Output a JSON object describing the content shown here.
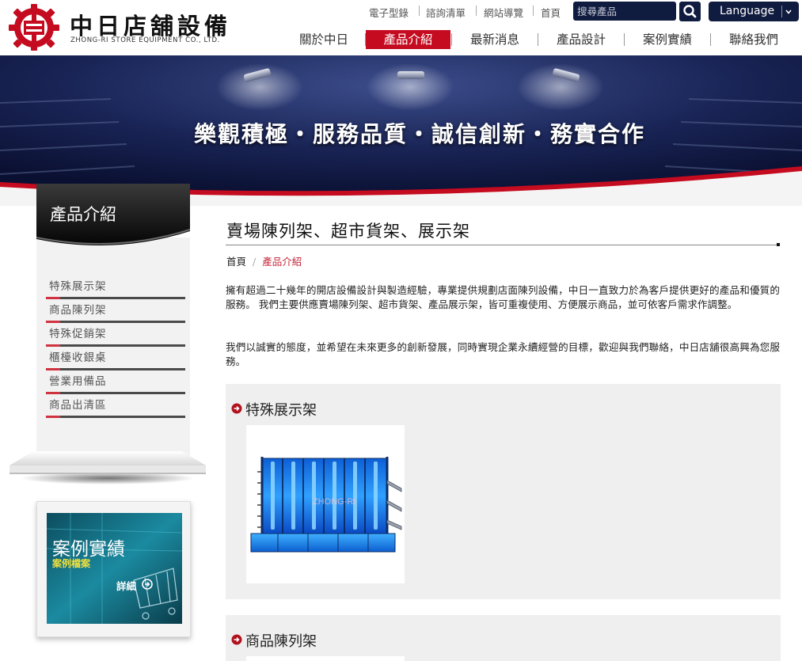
{
  "header": {
    "logo_cn": "中日店舖設備",
    "logo_en": "ZHONG-RI STORE EQUIPMENT CO., LTD.",
    "top_links": [
      "電子型錄",
      "諮詢清單",
      "網站導覽",
      "首頁"
    ],
    "search": {
      "placeholder": "搜尋產品",
      "icon": "search-icon"
    },
    "language": {
      "label": "Language",
      "icon": "chevron-down-icon"
    },
    "nav": [
      "關於中日",
      "產品介紹",
      "最新消息",
      "產品設計",
      "案例實績",
      "聯絡我們"
    ],
    "nav_active": "產品介紹",
    "colors": {
      "brand_red": "#c50b1f",
      "navy": "#0f1b3f"
    }
  },
  "banner": {
    "slogan": "樂觀積極・服務品質・誠信創新・務實合作"
  },
  "sidebar": {
    "title": "產品介紹",
    "items": [
      "特殊展示架",
      "商品陳列架",
      "特殊促銷架",
      "櫃檯收銀桌",
      "營業用備品",
      "商品出清區"
    ],
    "case_box": {
      "title": "案例實績",
      "subtitle": "案例檔案",
      "more": "詳細",
      "more_icon": "arrow-circle-right-icon"
    }
  },
  "main": {
    "title": "賣場陳列架、超市貨架、展示架",
    "breadcrumb": {
      "home": "首頁",
      "separator": "/",
      "current": "產品介紹"
    },
    "intro": [
      "擁有超過二十幾年的開店設備設計與製造經驗，專業提供規劃店面陳列設備，中日一直致力於為客戶提供更好的產品和優質的服務。 我們主要供應賣場陳列架、超市貨架、產品展示架，皆可重複使用、方便展示商品，並可依客戶需求作調整。",
      "我們以誠實的態度，並希望在未來更多的創新發展，同時實現企業永續經營的目標，歡迎與我們聯絡，中日店舖很高興為您服務。"
    ],
    "categories": [
      {
        "title": "特殊展示架",
        "icon": "arrow-circle-right-icon",
        "watermark": "ZHONG-RI"
      },
      {
        "title": "商品陳列架",
        "icon": "arrow-circle-right-icon"
      }
    ]
  }
}
